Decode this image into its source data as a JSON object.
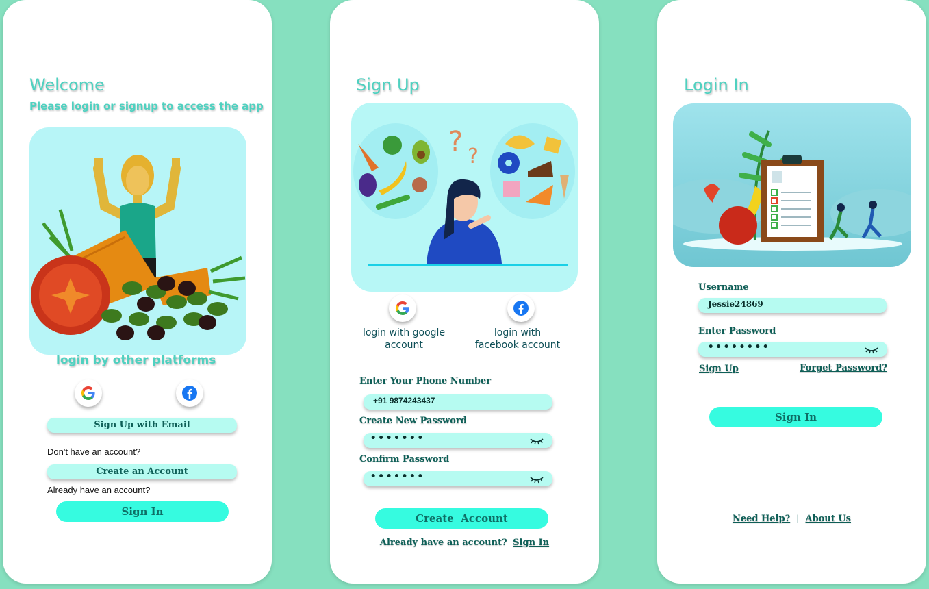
{
  "welcome": {
    "title": "Welcome",
    "subtitle": "Please login or signup to access the app",
    "other_platforms": "login by other platforms",
    "google_icon": "google-icon",
    "facebook_icon": "facebook-icon",
    "signup_email": "Sign Up with Email",
    "no_account": "Don't have an account?",
    "create_account": "Create an Account",
    "already": "Already have an account?",
    "sign_in": "Sign In"
  },
  "signup": {
    "title": "Sign Up",
    "google_label": "login with google account",
    "facebook_label": "login with facebook account",
    "phone_label": "Enter Your Phone Number",
    "phone_value": "+91 9874243437",
    "new_password_label": "Create New Password",
    "new_password_value": "•••••••",
    "confirm_label": "Confirm Password",
    "confirm_value": "•••••••",
    "create_button": "Create  Account",
    "already": "Already have an account?",
    "sign_in_link": "Sign In"
  },
  "login": {
    "title": "Login In",
    "username_label": "Username",
    "username_value": "Jessie24869",
    "password_label": "Enter Password",
    "password_value": "••••••••",
    "signup_link": "Sign Up",
    "forgot_link": "Forget Password?",
    "sign_in": "Sign In",
    "help_link": "Need Help?",
    "separator": "|",
    "about_link": "About Us"
  },
  "colors": {
    "background": "#86e0bf",
    "accent": "#36fbe0",
    "field": "#b6fbf1",
    "title": "#4fd1c0"
  }
}
